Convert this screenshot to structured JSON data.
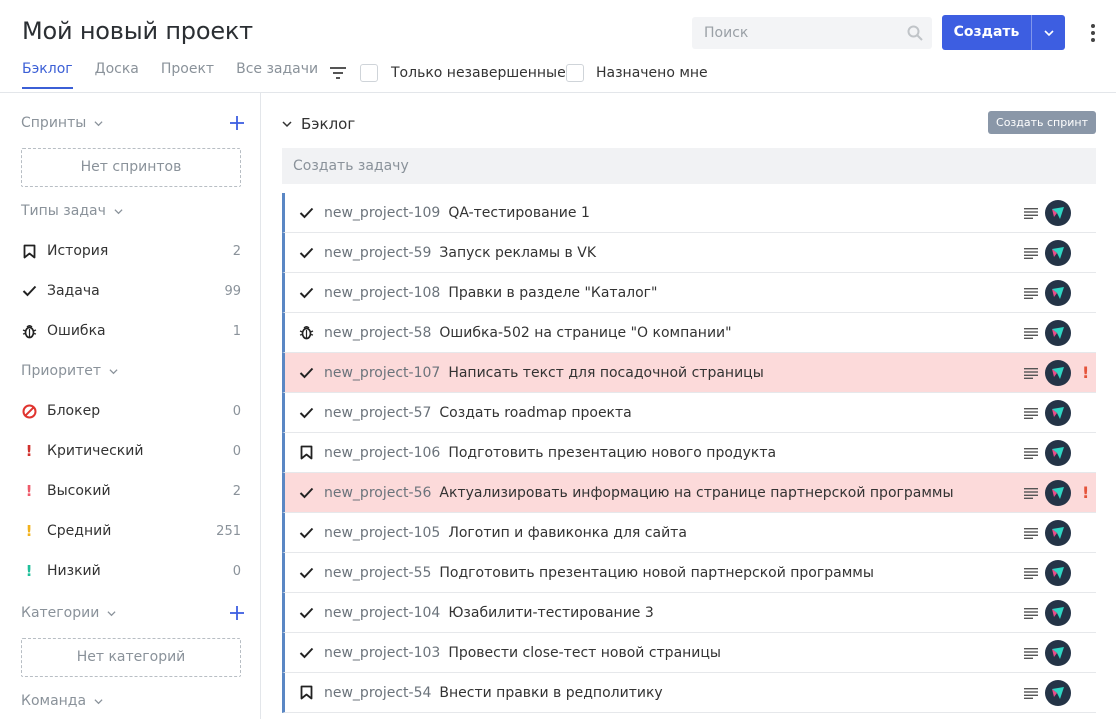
{
  "header": {
    "title": "Мой новый проект",
    "tabs": [
      "Бэклог",
      "Доска",
      "Проект",
      "Все задачи"
    ],
    "active_tab": "Бэклог",
    "filter_unfinished": "Только незавершенные",
    "filter_assigned": "Назначено мне",
    "search_placeholder": "Поиск",
    "create_label": "Создать"
  },
  "sidebar": {
    "sprints": {
      "title": "Спринты",
      "empty": "Нет спринтов"
    },
    "types": {
      "title": "Типы задач",
      "items": [
        {
          "label": "История",
          "count": "2",
          "icon": "bookmark-icon"
        },
        {
          "label": "Задача",
          "count": "99",
          "icon": "check-icon"
        },
        {
          "label": "Ошибка",
          "count": "1",
          "icon": "bug-icon"
        }
      ]
    },
    "priority": {
      "title": "Приоритет",
      "items": [
        {
          "label": "Блокер",
          "count": "0",
          "color": "#e0342f"
        },
        {
          "label": "Критический",
          "count": "0",
          "color": "#d0312d"
        },
        {
          "label": "Высокий",
          "count": "2",
          "color": "#ee5a6a"
        },
        {
          "label": "Средний",
          "count": "251",
          "color": "#f2b21c"
        },
        {
          "label": "Низкий",
          "count": "0",
          "color": "#1fbf9a"
        }
      ]
    },
    "categories": {
      "title": "Категории",
      "empty": "Нет категорий"
    },
    "team": {
      "title": "Команда"
    }
  },
  "main": {
    "backlog_title": "Бэклог",
    "create_sprint": "Создать спринт",
    "create_task_placeholder": "Создать задачу",
    "tasks": [
      {
        "type": "task",
        "key": "new_project-109",
        "name": "QA-тестирование 1",
        "highlight": false
      },
      {
        "type": "task",
        "key": "new_project-59",
        "name": "Запуск рекламы в VK",
        "highlight": false
      },
      {
        "type": "task",
        "key": "new_project-108",
        "name": "Правки в разделе \"Каталог\"",
        "highlight": false
      },
      {
        "type": "bug",
        "key": "new_project-58",
        "name": "Ошибка-502 на странице \"О компании\"",
        "highlight": false
      },
      {
        "type": "task",
        "key": "new_project-107",
        "name": "Написать текст для посадочной страницы",
        "highlight": true
      },
      {
        "type": "task",
        "key": "new_project-57",
        "name": "Создать roadmap проекта",
        "highlight": false
      },
      {
        "type": "story",
        "key": "new_project-106",
        "name": "Подготовить презентацию нового продукта",
        "highlight": false
      },
      {
        "type": "task",
        "key": "new_project-56",
        "name": "Актуализировать информацию на странице партнерской программы",
        "highlight": true
      },
      {
        "type": "task",
        "key": "new_project-105",
        "name": "Логотип и фавиконка для сайта",
        "highlight": false
      },
      {
        "type": "task",
        "key": "new_project-55",
        "name": "Подготовить презентацию новой партнерской программы",
        "highlight": false
      },
      {
        "type": "task",
        "key": "new_project-104",
        "name": "Юзабилити-тестирование 3",
        "highlight": false
      },
      {
        "type": "task",
        "key": "new_project-103",
        "name": "Провести close-тест новой страницы",
        "highlight": false
      },
      {
        "type": "story",
        "key": "new_project-54",
        "name": "Внести правки в редполитику",
        "highlight": false
      }
    ]
  },
  "colors": {
    "accent": "#3d5ee1",
    "highlight": "#fcdada",
    "row_border": "#5a87c4",
    "priority_high": "#e5533a"
  }
}
